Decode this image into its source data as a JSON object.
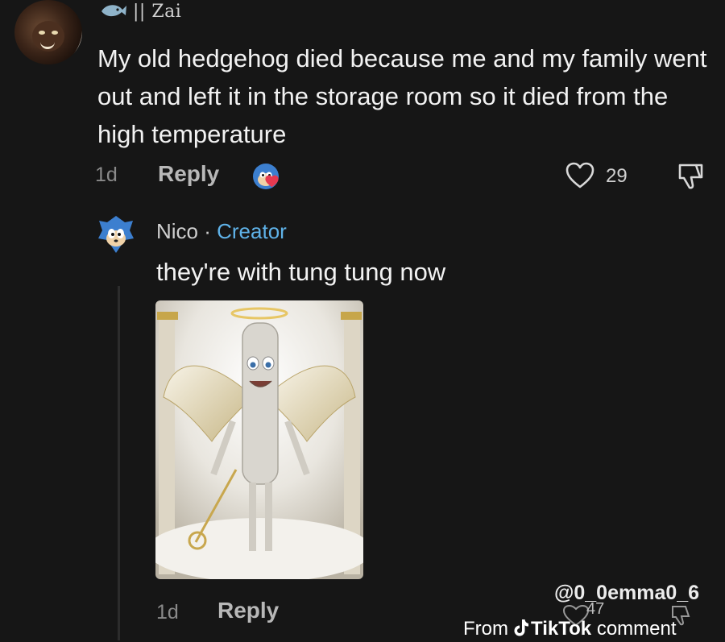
{
  "comment": {
    "username": "|| Zai",
    "text": "My old hedgehog died because me and my family went out and left it in the storage room so it died from the high temperature",
    "time": "1d",
    "reply_label": "Reply",
    "like_count": "29",
    "icons": [
      "user-avatar",
      "fish-badge-icon",
      "creator-liked-avatar",
      "heart-icon",
      "dislike-icon"
    ]
  },
  "reply": {
    "username": "Nico",
    "separator": " · ",
    "badge": "Creator",
    "text": "they're with tung tung now",
    "time": "1d",
    "reply_label": "Reply",
    "image_description_icon": "angel-image"
  },
  "watermark": {
    "handle": "@0_0emma0_6",
    "count": "47",
    "from": "From",
    "brand": "TikTok",
    "suffix": "comment"
  },
  "colors": {
    "background": "#161616",
    "creator": "#5fb2e8",
    "heart": "#e63950"
  }
}
